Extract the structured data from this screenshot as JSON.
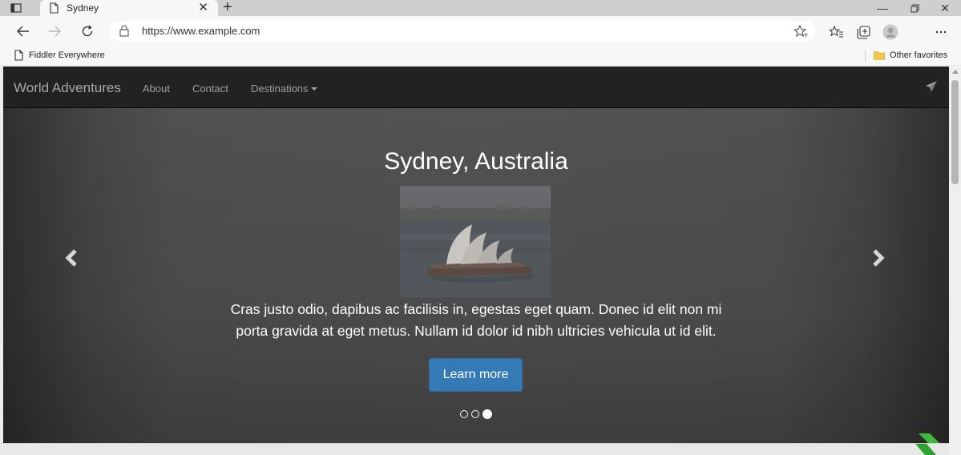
{
  "browser": {
    "tab_title": "Sydney",
    "new_tab_label": "+",
    "url": "https://www.example.com",
    "bookmarks": [
      {
        "label": "Fiddler Everywhere"
      },
      {
        "label": "Other favorites"
      }
    ],
    "colors": {
      "bookmark_folder": "#f2c94c"
    }
  },
  "site": {
    "brand": "World Adventures",
    "nav": [
      {
        "label": "About"
      },
      {
        "label": "Contact"
      },
      {
        "label": "Destinations"
      }
    ]
  },
  "carousel": {
    "title": "Sydney, Australia",
    "text_line1": "Cras justo odio, dapibus ac facilisis in, egestas eget quam. Donec id elit non mi",
    "text_line2": "porta gravida at eget metus. Nullam id dolor id nibh ultricies vehicula ut id elit.",
    "button_label": "Learn more",
    "slide_count": 3,
    "active_index": 2,
    "colors": {
      "button": "#337ab7",
      "navbar": "#222222"
    }
  }
}
